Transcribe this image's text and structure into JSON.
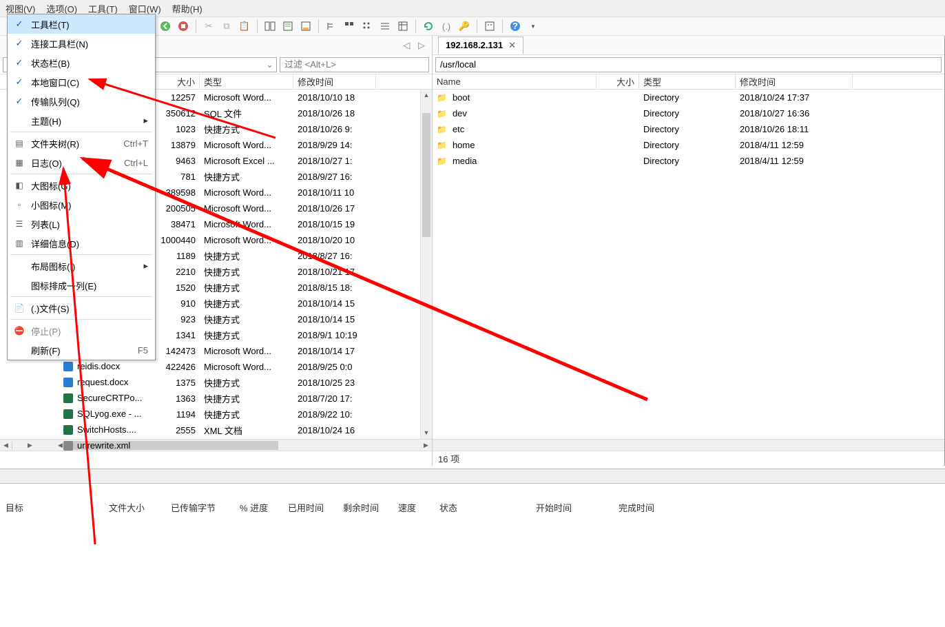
{
  "menubar": [
    "视图(V)",
    "选项(O)",
    "工具(T)",
    "窗口(W)",
    "帮助(H)"
  ],
  "dropdown": {
    "items": [
      {
        "check": true,
        "label": "工具栏(T)",
        "hl": true
      },
      {
        "check": true,
        "label": "连接工具栏(N)"
      },
      {
        "check": true,
        "label": "状态栏(B)"
      },
      {
        "check": true,
        "label": "本地窗口(C)"
      },
      {
        "check": true,
        "label": "传输队列(Q)"
      },
      {
        "label": "主题(H)",
        "submenu": true,
        "sep_after": true
      },
      {
        "icon": "tree",
        "label": "文件夹树(R)",
        "shortcut": "Ctrl+T"
      },
      {
        "icon": "log",
        "label": "日志(O)",
        "shortcut": "Ctrl+L",
        "sep_after": true
      },
      {
        "icon": "large",
        "label": "大图标(G)"
      },
      {
        "icon": "small",
        "label": "小图标(M)"
      },
      {
        "icon": "list",
        "label": "列表(L)"
      },
      {
        "icon": "detail",
        "label": "详细信息(D)",
        "sep_after": true
      },
      {
        "label": "布局图标(I)",
        "submenu": true
      },
      {
        "label": "图标排成一列(E)",
        "sep_after": true
      },
      {
        "icon": "dotfiles",
        "label": "(.)文件(S)",
        "sep_after": true
      },
      {
        "icon": "stop",
        "label": "停止(P)",
        "disabled": true
      },
      {
        "label": "刷新(F)",
        "shortcut": "F5"
      }
    ]
  },
  "left": {
    "filter_placeholder": "过滤 <Alt+L>",
    "headers": {
      "size": "大小",
      "type": "类型",
      "date": "修改时间"
    },
    "rows": [
      {
        "size": "12257",
        "type": "Microsoft Word...",
        "date": "2018/10/10 18"
      },
      {
        "size": "350612",
        "type": "SQL 文件",
        "date": "2018/10/26 18"
      },
      {
        "size": "1023",
        "type": "快捷方式",
        "date": "2018/10/26 9:"
      },
      {
        "size": "13879",
        "type": "Microsoft Word...",
        "date": "2018/9/29 14:"
      },
      {
        "size": "9463",
        "type": "Microsoft Excel ...",
        "date": "2018/10/27 1:"
      },
      {
        "size": "781",
        "type": "快捷方式",
        "date": "2018/9/27 16:"
      },
      {
        "size": "389598",
        "type": "Microsoft Word...",
        "date": "2018/10/11 10"
      },
      {
        "size": "200505",
        "type": "Microsoft Word...",
        "date": "2018/10/26 17"
      },
      {
        "size": "38471",
        "type": "Microsoft Word...",
        "date": "2018/10/15 19"
      },
      {
        "size": "1000440",
        "type": "Microsoft Word...",
        "date": "2018/10/20 10"
      },
      {
        "size": "1189",
        "type": "快捷方式",
        "date": "2018/8/27 16:"
      },
      {
        "size": "2210",
        "type": "快捷方式",
        "date": "2018/10/21 17"
      },
      {
        "size": "1520",
        "type": "快捷方式",
        "date": "2018/8/15 18:"
      },
      {
        "size": "910",
        "type": "快捷方式",
        "date": "2018/10/14 15"
      },
      {
        "size": "923",
        "type": "快捷方式",
        "date": "2018/10/14 15"
      },
      {
        "size": "1341",
        "type": "快捷方式",
        "date": "2018/9/1 10:19"
      },
      {
        "size": "142473",
        "type": "Microsoft Word...",
        "date": "2018/10/14 17"
      },
      {
        "size": "422426",
        "type": "Microsoft Word...",
        "date": "2018/9/25 0:0"
      },
      {
        "size": "1375",
        "type": "快捷方式",
        "date": "2018/10/25 23"
      },
      {
        "size": "1363",
        "type": "快捷方式",
        "date": "2018/7/20 17:"
      },
      {
        "size": "1194",
        "type": "快捷方式",
        "date": "2018/9/22 10:"
      },
      {
        "size": "2555",
        "type": "XML 文档",
        "date": "2018/10/24 16"
      }
    ],
    "tailnames": [
      {
        "icon": "word",
        "name": "reidis.docx"
      },
      {
        "icon": "word",
        "name": "request.docx"
      },
      {
        "icon": "app",
        "name": "SecureCRTPo..."
      },
      {
        "icon": "app",
        "name": "SQLyog.exe - ..."
      },
      {
        "icon": "app",
        "name": "SwitchHosts...."
      },
      {
        "icon": "xml",
        "name": "urlrewrite.xml"
      }
    ]
  },
  "right": {
    "tab": "192.168.2.131",
    "path": "/usr/local",
    "headers": {
      "name": "Name",
      "size": "大小",
      "type": "类型",
      "date": "修改时间"
    },
    "rows": [
      {
        "name": "boot",
        "type": "Directory",
        "date": "2018/10/24 17:37"
      },
      {
        "name": "dev",
        "type": "Directory",
        "date": "2018/10/27 16:36"
      },
      {
        "name": "etc",
        "type": "Directory",
        "date": "2018/10/26 18:11"
      },
      {
        "name": "home",
        "type": "Directory",
        "date": "2018/4/11 12:59"
      },
      {
        "name": "media",
        "type": "Directory",
        "date": "2018/4/11 12:59"
      }
    ],
    "status": "16 项"
  },
  "queue": {
    "cols": [
      "目标",
      "文件大小",
      "已传输字节",
      "% 进度",
      "已用时间",
      "剩余时间",
      "速度",
      "状态",
      "开始时间",
      "完成时间"
    ]
  }
}
